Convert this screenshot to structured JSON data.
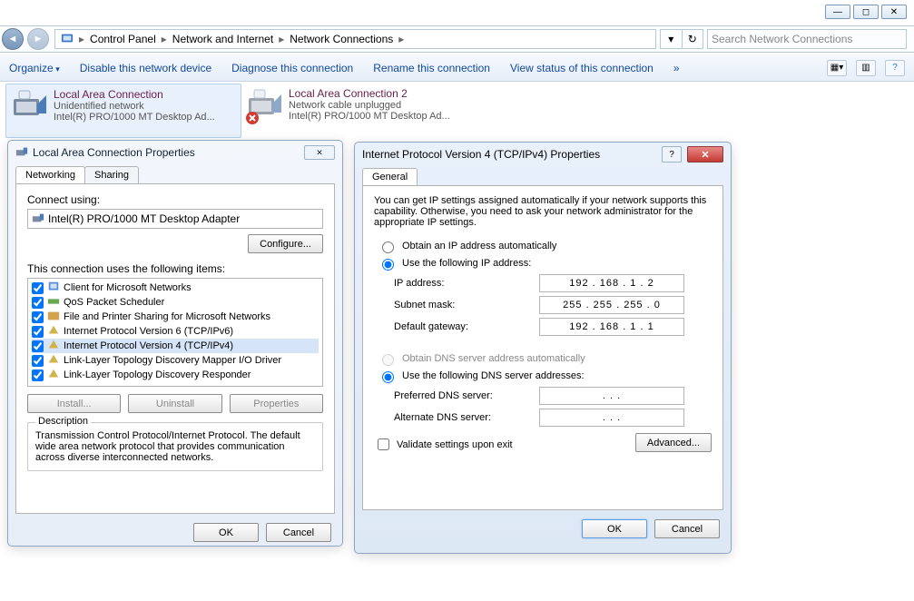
{
  "window_controls": {
    "min": "—",
    "max": "◻",
    "close": "✕"
  },
  "breadcrumb": {
    "parts": [
      "Control Panel",
      "Network and Internet",
      "Network Connections"
    ]
  },
  "search": {
    "placeholder": "Search Network Connections"
  },
  "toolbar": {
    "organize": "Organize",
    "disable": "Disable this network device",
    "diagnose": "Diagnose this connection",
    "rename": "Rename this connection",
    "viewstatus": "View status of this connection",
    "more": "»"
  },
  "connections": [
    {
      "title": "Local Area Connection",
      "sub1": "Unidentified network",
      "sub2": "Intel(R) PRO/1000 MT Desktop Ad..."
    },
    {
      "title": "Local Area Connection 2",
      "sub1": "Network cable unplugged",
      "sub2": "Intel(R) PRO/1000 MT Desktop Ad..."
    }
  ],
  "propsDialog": {
    "title": "Local Area Connection Properties",
    "tabs": {
      "networking": "Networking",
      "sharing": "Sharing"
    },
    "connect_using_label": "Connect using:",
    "adapter": "Intel(R) PRO/1000 MT Desktop Adapter",
    "configure": "Configure...",
    "items_label": "This connection uses the following items:",
    "items": [
      "Client for Microsoft Networks",
      "QoS Packet Scheduler",
      "File and Printer Sharing for Microsoft Networks",
      "Internet Protocol Version 6 (TCP/IPv6)",
      "Internet Protocol Version 4 (TCP/IPv4)",
      "Link-Layer Topology Discovery Mapper I/O Driver",
      "Link-Layer Topology Discovery Responder"
    ],
    "install": "Install...",
    "uninstall": "Uninstall",
    "properties": "Properties",
    "desc_label": "Description",
    "desc_text": "Transmission Control Protocol/Internet Protocol. The default wide area network protocol that provides communication across diverse interconnected networks.",
    "ok": "OK",
    "cancel": "Cancel"
  },
  "ipDialog": {
    "title": "Internet Protocol Version 4 (TCP/IPv4) Properties",
    "tab": "General",
    "intro": "You can get IP settings assigned automatically if your network supports this capability. Otherwise, you need to ask your network administrator for the appropriate IP settings.",
    "radio_auto_ip": "Obtain an IP address automatically",
    "radio_manual_ip": "Use the following IP address:",
    "ip_label": "IP address:",
    "ip_value": "192 . 168 .   1  .   2",
    "mask_label": "Subnet mask:",
    "mask_value": "255 . 255 . 255 .   0",
    "gw_label": "Default gateway:",
    "gw_value": "192 . 168 .   1  .   1",
    "radio_auto_dns": "Obtain DNS server address automatically",
    "radio_manual_dns": "Use the following DNS server addresses:",
    "pdns_label": "Preferred DNS server:",
    "pdns_value": ".        .        .",
    "adns_label": "Alternate DNS server:",
    "adns_value": ".        .        .",
    "validate": "Validate settings upon exit",
    "advanced": "Advanced...",
    "ok": "OK",
    "cancel": "Cancel"
  }
}
